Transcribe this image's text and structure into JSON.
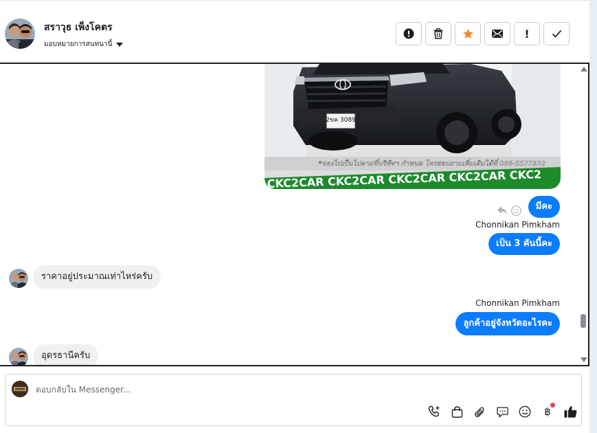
{
  "header": {
    "contact_name": "สราวุธ เพ็งโคตร",
    "assign_label": "มอบหมายการสนทนานี้"
  },
  "actions": [
    {
      "name": "report-button",
      "icon": "alert-circle-icon"
    },
    {
      "name": "delete-button",
      "icon": "trash-icon"
    },
    {
      "name": "star-button",
      "icon": "star-icon"
    },
    {
      "name": "mark-unread-button",
      "icon": "envelope-icon"
    },
    {
      "name": "follow-up-button",
      "icon": "exclamation-icon",
      "text": "!"
    },
    {
      "name": "mark-done-button",
      "icon": "check-icon"
    }
  ],
  "colors": {
    "accent": "#0a7cff",
    "star": "#f28c28",
    "incoming_bubble": "#f0f0f0",
    "notification_dot": "#e4405f"
  },
  "chat": {
    "image_caption": "*จองไปเป็นไปตามที่บริษัทฯ กำหนด โทรสอบถามเพิ่มเติมได้ที่ 088-5577932",
    "image_banner": "CKC2CAR CKC2CAR CKC2CAR CKC2CAR CKC2",
    "plate": "2ขค 3089",
    "messages": [
      {
        "dir": "out",
        "text": "มีคะ"
      },
      {
        "dir": "out",
        "sender": "Chonnikan Pimkham",
        "text": "เป็น 3 คันนี้คะ"
      },
      {
        "dir": "in",
        "text": "ราคาอยู่ประมาณเท่าไหร่ครับ"
      },
      {
        "dir": "out",
        "sender": "Chonnikan Pimkham",
        "text": "ลูกค้าอยู่จังหวัดอะไรคะ"
      },
      {
        "dir": "in",
        "text": "อุดรธานีครับ"
      }
    ]
  },
  "composer": {
    "placeholder": "ตอบกลับใน Messenger...",
    "currency_symbol": "฿"
  }
}
